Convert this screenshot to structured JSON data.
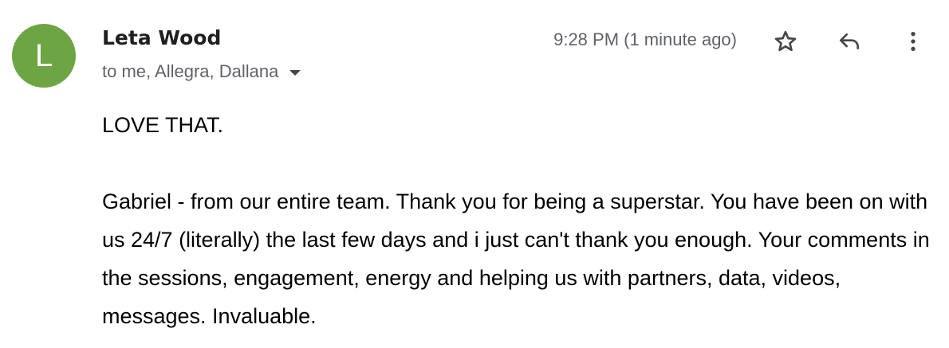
{
  "avatar": {
    "letter": "L",
    "color": "#6ea544"
  },
  "sender": {
    "name": "Leta Wood"
  },
  "recipients": {
    "text": "to me, Allegra, Dallana"
  },
  "timestamp": "9:28 PM (1 minute ago)",
  "actions": {
    "star_icon": "star-outline-icon",
    "reply_icon": "reply-icon",
    "more_icon": "more-vertical-icon"
  },
  "body": {
    "line1": "LOVE THAT.",
    "paragraph2": "Gabriel - from our entire team. Thank you for being a superstar. You have been on with us 24/7 (literally) the last few days and i just can't thank you enough. Your comments in the sessions, engagement, energy and helping us with partners, data, videos, messages. Invaluable."
  }
}
